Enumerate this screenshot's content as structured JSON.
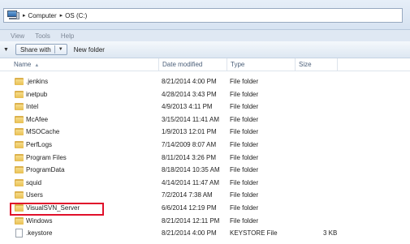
{
  "address_bar": {
    "icon": "computer-icon",
    "breadcrumb": [
      {
        "label": "Computer"
      },
      {
        "label": "OS (C:)"
      }
    ]
  },
  "menu": [
    "View",
    "Tools",
    "Help"
  ],
  "toolbar": {
    "share_with": "Share with",
    "new_folder": "New folder"
  },
  "columns": {
    "name": "Name",
    "date_modified": "Date modified",
    "type": "Type",
    "size": "Size"
  },
  "rows": [
    {
      "name": ".jenkins",
      "date": "8/21/2014 4:00 PM",
      "type": "File folder",
      "size": "",
      "icon": "folder-icon"
    },
    {
      "name": "inetpub",
      "date": "4/28/2014 3:43 PM",
      "type": "File folder",
      "size": "",
      "icon": "folder-icon"
    },
    {
      "name": "Intel",
      "date": "4/9/2013 4:11 PM",
      "type": "File folder",
      "size": "",
      "icon": "folder-icon"
    },
    {
      "name": "McAfee",
      "date": "3/15/2014 11:41 AM",
      "type": "File folder",
      "size": "",
      "icon": "folder-icon"
    },
    {
      "name": "MSOCache",
      "date": "1/9/2013 12:01 PM",
      "type": "File folder",
      "size": "",
      "icon": "folder-icon"
    },
    {
      "name": "PerfLogs",
      "date": "7/14/2009 8:07 AM",
      "type": "File folder",
      "size": "",
      "icon": "folder-icon"
    },
    {
      "name": "Program Files",
      "date": "8/11/2014 3:26 PM",
      "type": "File folder",
      "size": "",
      "icon": "folder-icon"
    },
    {
      "name": "ProgramData",
      "date": "8/18/2014 10:35 AM",
      "type": "File folder",
      "size": "",
      "icon": "folder-icon"
    },
    {
      "name": "squid",
      "date": "4/14/2014 11:47 AM",
      "type": "File folder",
      "size": "",
      "icon": "folder-icon"
    },
    {
      "name": "Users",
      "date": "7/2/2014 7:38 AM",
      "type": "File folder",
      "size": "",
      "icon": "folder-icon"
    },
    {
      "name": "VisualSVN_Server",
      "date": "6/6/2014 12:19 PM",
      "type": "File folder",
      "size": "",
      "icon": "folder-icon"
    },
    {
      "name": "Windows",
      "date": "8/21/2014 12:11 PM",
      "type": "File folder",
      "size": "",
      "icon": "folder-icon"
    },
    {
      "name": ".keystore",
      "date": "8/21/2014 4:00 PM",
      "type": "KEYSTORE File",
      "size": "3 KB",
      "icon": "file-icon"
    }
  ],
  "colors": {
    "highlight": "#e0102a",
    "folder": "#e8bf52"
  }
}
